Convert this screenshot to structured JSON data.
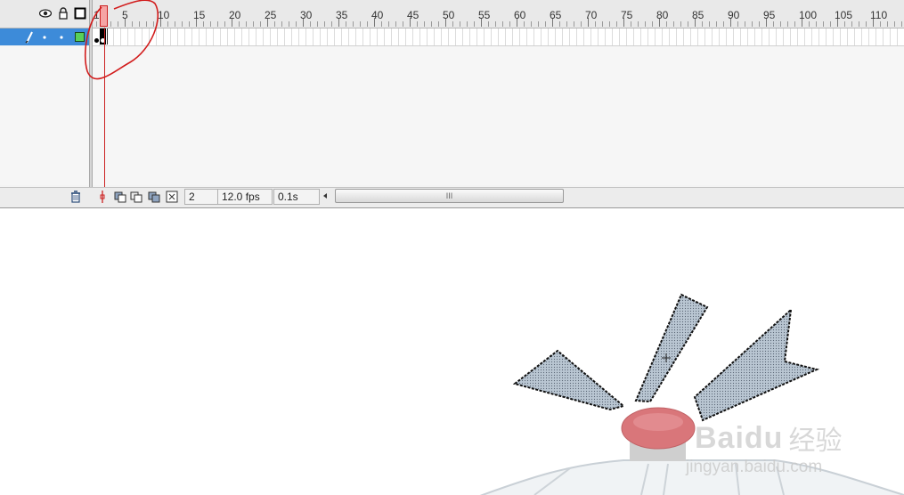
{
  "ruler": {
    "frame_numbers": [
      "1",
      "5",
      "10",
      "15",
      "20",
      "25",
      "30",
      "35",
      "40",
      "45",
      "50",
      "55",
      "60",
      "65",
      "70",
      "75",
      "80",
      "85",
      "90",
      "95",
      "100",
      "105",
      "110"
    ]
  },
  "layers": {
    "header_icons": [
      "eye-icon",
      "lock-icon",
      "outline-icon"
    ],
    "row_icons": [
      "pencil-icon",
      "dot-icon",
      "dot-icon",
      "layer-color-swatch"
    ]
  },
  "status": {
    "current_frame": "2",
    "fps": "12.0 fps",
    "elapsed": "0.1s",
    "scroll_thumb_label": "III"
  },
  "watermark": {
    "brand": "Baidu",
    "brand_cn": "经验",
    "url": "jingyan.baidu.com"
  },
  "colors": {
    "selected_layer": "#3d8bd9",
    "playhead": "#cc2222",
    "layer_swatch": "#58d05a",
    "shape_fill": "#b9c6d2",
    "button_red": "#d9767a"
  }
}
